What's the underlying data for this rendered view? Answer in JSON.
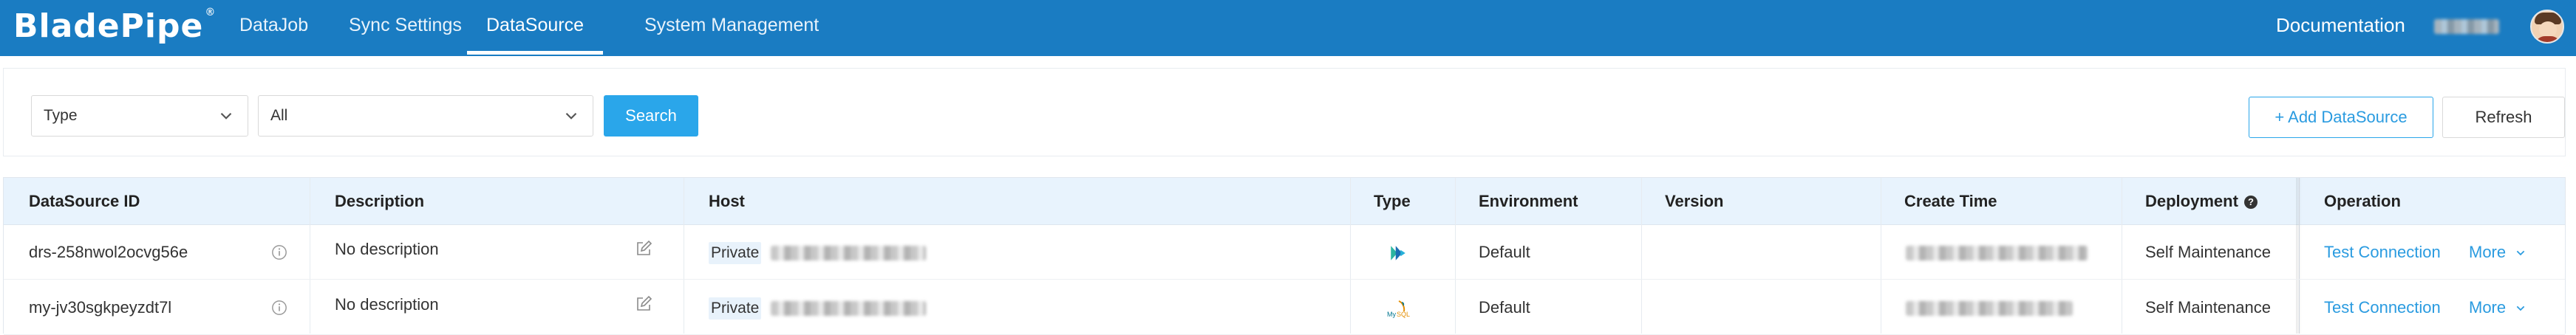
{
  "app": {
    "logo_text": "BladePipe",
    "logo_mark": "®"
  },
  "nav": {
    "tabs": [
      {
        "label": "DataJob",
        "active": false
      },
      {
        "label": "Sync Settings",
        "active": false
      },
      {
        "label": "DataSource",
        "active": true
      },
      {
        "label": "System Management",
        "active": false
      }
    ],
    "documentation": "Documentation"
  },
  "filters": {
    "type_select": "Type",
    "scope_select": "All",
    "search_label": "Search",
    "add_label": "+ Add DataSource",
    "refresh_label": "Refresh"
  },
  "table": {
    "columns": [
      "DataSource ID",
      "Description",
      "Host",
      "Type",
      "Environment",
      "Version",
      "Create Time",
      "Deployment",
      "Operation"
    ],
    "rows": [
      {
        "id": "drs-258nwol2ocvg56e",
        "description": "No description",
        "host_tag": "Private",
        "type_icon": "bladepipe-type-icon",
        "environment": "Default",
        "version": "",
        "deployment": "Self Maintenance",
        "op_test": "Test Connection",
        "op_more": "More"
      },
      {
        "id": "my-jv30sgkpeyzdt7l",
        "description": "No description",
        "host_tag": "Private",
        "type_icon": "mysql-type-icon",
        "environment": "Default",
        "version": "",
        "deployment": "Self Maintenance",
        "op_test": "Test Connection",
        "op_more": "More"
      }
    ]
  },
  "colors": {
    "topbar": "#1a7cc2",
    "primary": "#2aa6ea",
    "header_bg": "#e8f3fd",
    "link": "#2a9be0"
  }
}
